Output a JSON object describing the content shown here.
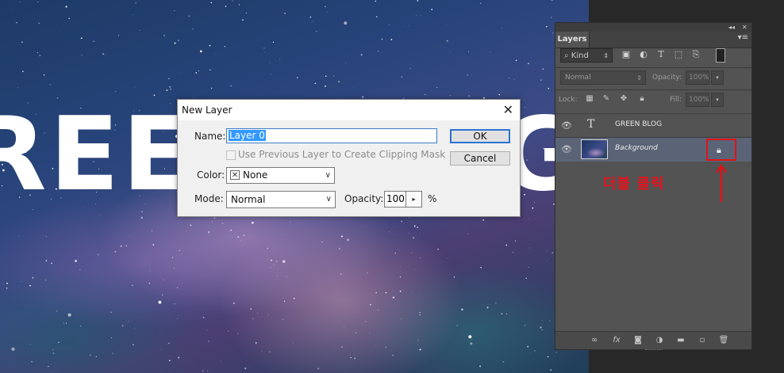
{
  "canvas": {
    "text_left": "REEN",
    "text_right": "G"
  },
  "layers_panel": {
    "tab": "Layers",
    "filter": {
      "kind": "Kind",
      "icons": [
        "image-filter-icon",
        "adjustment-filter-icon",
        "type-filter-icon",
        "shape-filter-icon",
        "smartobject-filter-icon",
        "filter-toggle-icon"
      ]
    },
    "blend_mode": "Normal",
    "opacity_label": "Opacity:",
    "opacity_value": "100%",
    "lock_label": "Lock:",
    "fill_label": "Fill:",
    "fill_value": "100%",
    "layers": [
      {
        "name": "GREEN BLOG",
        "type": "text"
      },
      {
        "name": "Background",
        "type": "image",
        "locked": true
      }
    ],
    "annotation": "더블 클릭",
    "accent_color": "#e0131a"
  },
  "dialog": {
    "title": "New Layer",
    "name_label": "Name:",
    "name_value": "Layer 0",
    "clip_label": "Use Previous Layer to Create Clipping Mask",
    "color_label": "Color:",
    "color_value": "None",
    "mode_label": "Mode:",
    "mode_value": "Normal",
    "opacity_label": "Opacity:",
    "opacity_value": "100",
    "opacity_unit": "%",
    "ok": "OK",
    "cancel": "Cancel"
  }
}
